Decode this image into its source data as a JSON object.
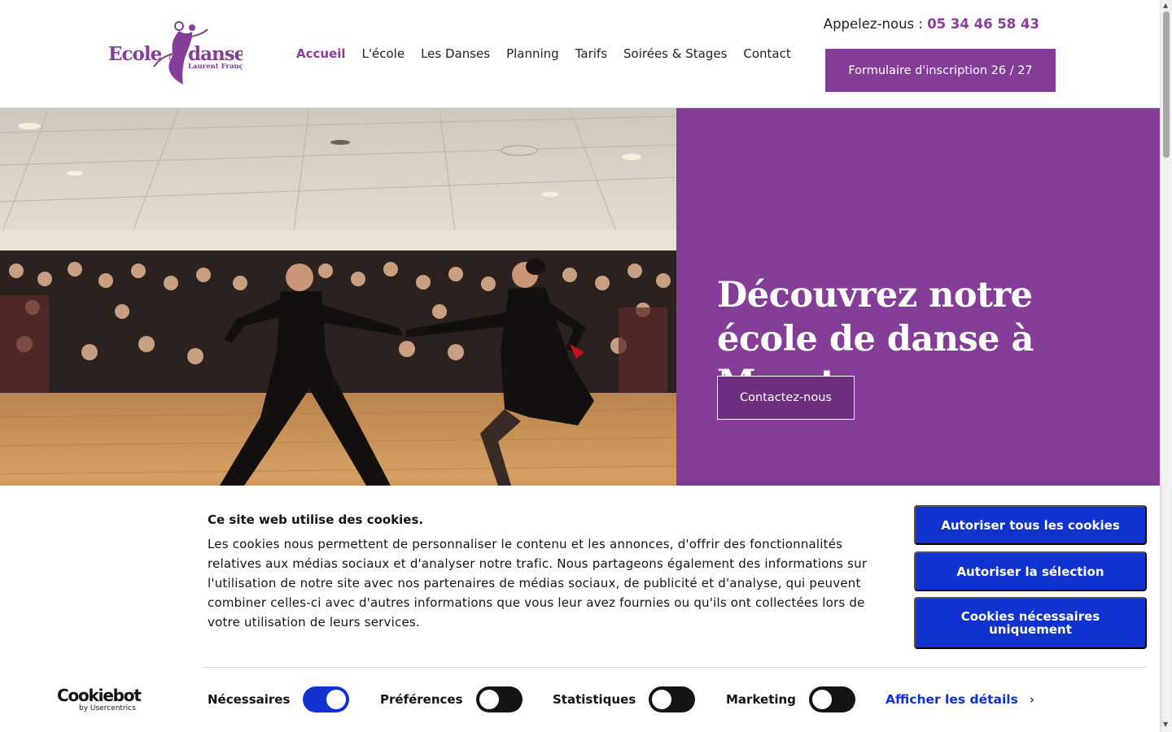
{
  "header": {
    "logo": {
      "main": "Ecole",
      "de": "de",
      "danse": "danse",
      "sub": "Laurent Françon"
    },
    "nav": [
      {
        "label": "Accueil",
        "active": true
      },
      {
        "label": "L'école"
      },
      {
        "label": "Les Danses"
      },
      {
        "label": "Planning"
      },
      {
        "label": "Tarifs"
      },
      {
        "label": "Soirées & Stages"
      },
      {
        "label": "Contact"
      }
    ],
    "phone_label": "Appelez-nous : ",
    "phone_number": "05 34 46 58 43",
    "cta_label": "Formulaire d'inscription 26 / 27"
  },
  "hero": {
    "title": "Découvrez notre école de danse à Muret",
    "button_label": "Contactez-nous"
  },
  "cookie": {
    "title": "Ce site web utilise des cookies.",
    "text": "Les cookies nous permettent de personnaliser le contenu et les annonces, d'offrir des fonctionnalités relatives aux médias sociaux et d'analyser notre trafic. Nous partageons également des informations sur l'utilisation de notre site avec nos partenaires de médias sociaux, de publicité et d'analyse, qui peuvent combiner celles-ci avec d'autres informations que vous leur avez fournies ou qu'ils ont collectées lors de votre utilisation de leurs services.",
    "buttons": {
      "allow_all": "Autoriser tous les cookies",
      "allow_selection": "Autoriser la sélection",
      "necessary_only": "Cookies nécessaires uniquement"
    },
    "brand": {
      "name": "Cookiebot",
      "by": "by Usercentrics"
    },
    "toggles": [
      {
        "label": "Nécessaires",
        "on": true
      },
      {
        "label": "Préférences",
        "on": false
      },
      {
        "label": "Statistiques",
        "on": false
      },
      {
        "label": "Marketing",
        "on": false
      }
    ],
    "details_link": "Afficher les détails"
  },
  "colors": {
    "brand_purple": "#843e97",
    "cookie_blue": "#1032cf"
  },
  "icons": {
    "chevron": "chevron-right-icon",
    "scroll_up": "scroll-up-arrow-icon",
    "scroll_down": "scroll-down-arrow-icon"
  }
}
